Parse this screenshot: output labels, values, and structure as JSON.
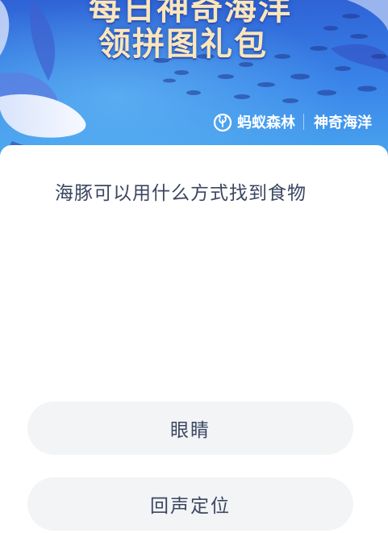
{
  "banner": {
    "title_line1": "每日神奇海洋",
    "title_line2": "领拼图礼包",
    "brand_name": "蚂蚁森林",
    "brand_sub": "神奇海洋",
    "icons": [
      "antforest-logo-icon"
    ],
    "colors": {
      "sky_top": "#2f63d6",
      "sky_bottom": "#4aa6ee",
      "title_text": "#fbe6bb"
    }
  },
  "quiz": {
    "question": "海豚可以用什么方式找到食物",
    "options": [
      {
        "label": "眼睛"
      },
      {
        "label": "回声定位"
      }
    ],
    "colors": {
      "text": "#3b4660",
      "option_bg": "#f2f4f6"
    }
  }
}
